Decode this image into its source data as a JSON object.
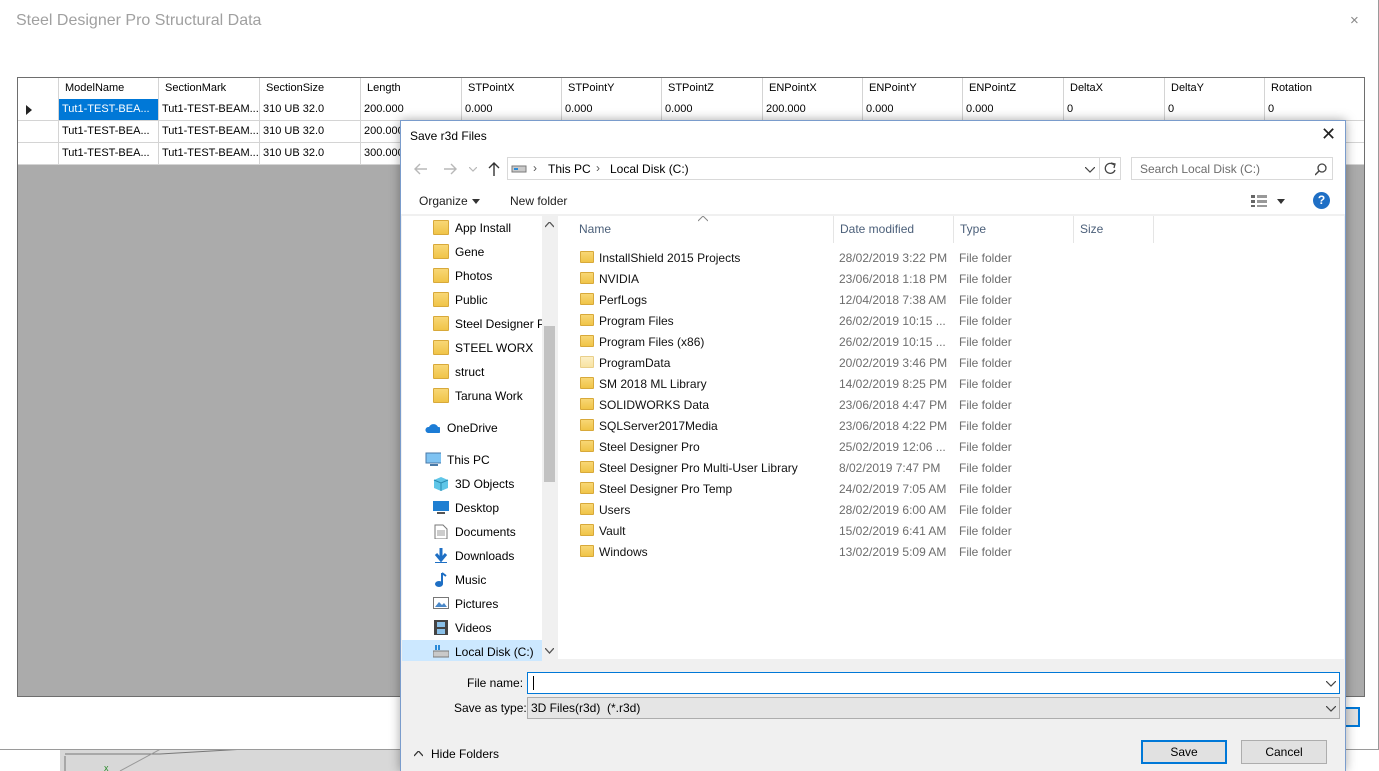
{
  "main": {
    "title": "Steel Designer Pro Structural Data",
    "close_glyph": "×",
    "grid": {
      "columns": [
        "ModelName",
        "SectionMark",
        "SectionSize",
        "Length",
        "STPointX",
        "STPointY",
        "STPointZ",
        "ENPointX",
        "ENPointY",
        "ENPointZ",
        "DeltaX",
        "DeltaY",
        "Rotation"
      ],
      "rows": [
        [
          "Tut1-TEST-BEA...",
          "Tut1-TEST-BEAM...",
          "310 UB 32.0",
          "200.000",
          "0.000",
          "0.000",
          "0.000",
          "200.000",
          "0.000",
          "0.000",
          "0",
          "0",
          "0"
        ],
        [
          "Tut1-TEST-BEA...",
          "Tut1-TEST-BEAM...",
          "310 UB 32.0",
          "200.000"
        ],
        [
          "Tut1-TEST-BEA...",
          "Tut1-TEST-BEAM...",
          "310 UB 32.0",
          "300.000"
        ]
      ]
    }
  },
  "dialog": {
    "title": "Save r3d Files",
    "close_glyph": "✕",
    "address": {
      "segments": [
        "This PC",
        "Local Disk (C:)"
      ],
      "separator": "›"
    },
    "search_placeholder": "Search Local Disk (C:)",
    "toolbar": {
      "organize": "Organize",
      "new_folder": "New folder",
      "help": "?"
    },
    "nav_items": [
      {
        "label": "App Install",
        "icon": "user-folder-icon"
      },
      {
        "label": "Gene",
        "icon": "user-folder-icon"
      },
      {
        "label": "Photos",
        "icon": "shared-folder-icon"
      },
      {
        "label": "Public",
        "icon": "shared-folder-icon"
      },
      {
        "label": "Steel Designer Pr",
        "icon": "shared-folder-icon"
      },
      {
        "label": "STEEL WORX",
        "icon": "user-folder-icon"
      },
      {
        "label": "struct",
        "icon": "shared-folder-icon"
      },
      {
        "label": "Taruna Work",
        "icon": "user-folder-icon"
      },
      {
        "label": "OneDrive",
        "icon": "cloud-icon"
      },
      {
        "label": "This PC",
        "icon": "computer-icon"
      },
      {
        "label": "3D Objects",
        "icon": "cube-icon"
      },
      {
        "label": "Desktop",
        "icon": "desktop-icon"
      },
      {
        "label": "Documents",
        "icon": "document-icon"
      },
      {
        "label": "Downloads",
        "icon": "download-icon"
      },
      {
        "label": "Music",
        "icon": "music-icon"
      },
      {
        "label": "Pictures",
        "icon": "pictures-icon"
      },
      {
        "label": "Videos",
        "icon": "film-icon"
      },
      {
        "label": "Local Disk (C:)",
        "icon": "drive-icon"
      }
    ],
    "columns": {
      "name": "Name",
      "date": "Date modified",
      "type": "Type",
      "size": "Size"
    },
    "files": [
      {
        "name": "InstallShield 2015 Projects",
        "date": "28/02/2019 3:22 PM",
        "type": "File folder"
      },
      {
        "name": "NVIDIA",
        "date": "23/06/2018 1:18 PM",
        "type": "File folder"
      },
      {
        "name": "PerfLogs",
        "date": "12/04/2018 7:38 AM",
        "type": "File folder"
      },
      {
        "name": "Program Files",
        "date": "26/02/2019 10:15 ...",
        "type": "File folder"
      },
      {
        "name": "Program Files (x86)",
        "date": "26/02/2019 10:15 ...",
        "type": "File folder"
      },
      {
        "name": "ProgramData",
        "date": "20/02/2019 3:46 PM",
        "type": "File folder"
      },
      {
        "name": "SM 2018 ML Library",
        "date": "14/02/2019 8:25 PM",
        "type": "File folder"
      },
      {
        "name": "SOLIDWORKS Data",
        "date": "23/06/2018 4:47 PM",
        "type": "File folder"
      },
      {
        "name": "SQLServer2017Media",
        "date": "23/06/2018 4:22 PM",
        "type": "File folder"
      },
      {
        "name": "Steel Designer Pro",
        "date": "25/02/2019 12:06 ...",
        "type": "File folder"
      },
      {
        "name": "Steel Designer Pro Multi-User Library",
        "date": "8/02/2019 7:47 PM",
        "type": "File folder"
      },
      {
        "name": "Steel Designer Pro Temp",
        "date": "24/02/2019 7:05 AM",
        "type": "File folder"
      },
      {
        "name": "Users",
        "date": "28/02/2019 6:00 AM",
        "type": "File folder"
      },
      {
        "name": "Vault",
        "date": "15/02/2019 6:41 AM",
        "type": "File folder"
      },
      {
        "name": "Windows",
        "date": "13/02/2019 5:09 AM",
        "type": "File folder"
      }
    ],
    "file_name_label": "File name:",
    "file_name_value": "",
    "save_type_label": "Save as type:",
    "save_type_value": "3D Files(r3d)  (*.r3d)",
    "hide_folders": "Hide Folders",
    "save_button": "Save",
    "cancel_button": "Cancel"
  },
  "colors": {
    "accent": "#0078d7",
    "selection": "#cce8ff",
    "grid_background": "#ababab"
  }
}
